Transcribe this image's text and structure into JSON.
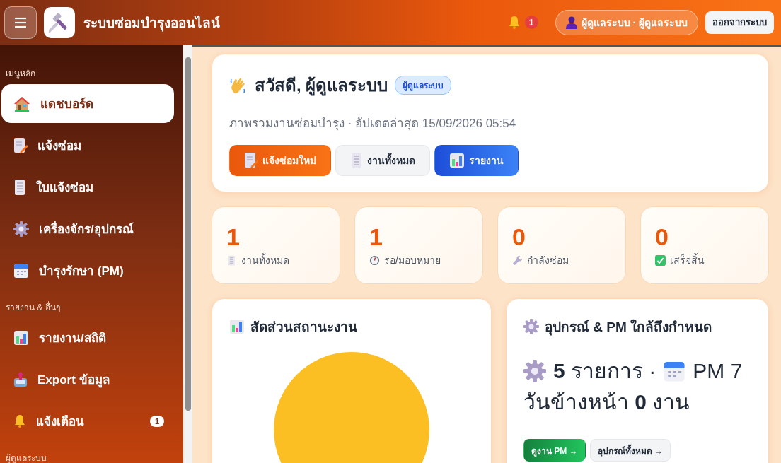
{
  "header": {
    "app_title": "ระบบซ่อมบำรุงออนไลน์",
    "notification_count": "1",
    "user": "ผู้ดูแลระบบ · ผู้ดูแลระบบ",
    "logout": "ออกจากระบบ"
  },
  "sidebar": {
    "sections": [
      {
        "title": "เมนูหลัก",
        "items": [
          {
            "label": "แดชบอร์ด",
            "selected": true
          },
          {
            "label": "แจ้งซ่อม",
            "selected": false
          },
          {
            "label": "ใบแจ้งซ่อม",
            "selected": false
          },
          {
            "label": "เครื่องจักร/อุปกรณ์",
            "selected": false
          },
          {
            "label": "บำรุงรักษา (PM)",
            "selected": false
          }
        ]
      },
      {
        "title": "รายงาน & อื่นๆ",
        "items": [
          {
            "label": "รายงาน/สถิติ",
            "selected": false
          },
          {
            "label": "Export ข้อมูล",
            "selected": false
          },
          {
            "label": "แจ้งเตือน",
            "selected": false,
            "badge": "1"
          }
        ]
      },
      {
        "title": "ผู้ดูแลระบบ"
      }
    ]
  },
  "welcome": {
    "greeting": "สวัสดี, ผู้ดูแลระบบ",
    "role_badge": "ผู้ดูแลระบบ",
    "subtitle": "ภาพรวมงานซ่อมบำรุง · อัปเดตล่าสุด 15/09/2026 05:54",
    "buttons": [
      {
        "label": "แจ้งซ่อมใหม่",
        "kind": "primary"
      },
      {
        "label": "งานทั้งหมด",
        "kind": "secondary"
      },
      {
        "label": "รายงาน",
        "kind": "info"
      }
    ]
  },
  "stats": [
    {
      "value": "1",
      "label": "งานทั้งหมด"
    },
    {
      "value": "1",
      "label": "รอ/มอบหมาย"
    },
    {
      "value": "0",
      "label": "กำลังซ่อม"
    },
    {
      "value": "0",
      "label": "เสร็จสิ้น"
    }
  ],
  "status_card": {
    "title": "สัดส่วนสถานะงาน"
  },
  "upcoming_card": {
    "title": "อุปกรณ์ & PM ใกล้ถึงกำหนด",
    "equipment_text": "**5** รายการ ·",
    "pm_text": "PM 7",
    "pm_days_text": "วันข้างหน้า **0** งาน",
    "buttons": [
      {
        "label": "ดูงาน PM →",
        "kind": "success"
      },
      {
        "label": "อุปกรณ์ทั้งหมด →",
        "kind": "secondary"
      }
    ]
  }
}
